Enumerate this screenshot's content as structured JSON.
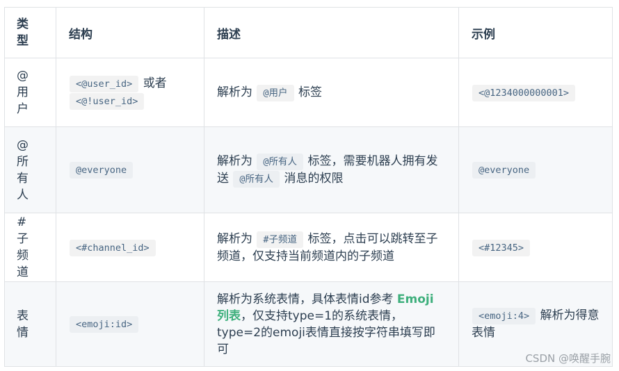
{
  "headers": {
    "type": "类型",
    "structure": "结构",
    "description": "描述",
    "example": "示例"
  },
  "rows": [
    {
      "type": "@用户",
      "structure_code1": "<@user_id>",
      "structure_sep": "或者",
      "structure_code2": "<@!user_id>",
      "desc_pre": "解析为",
      "desc_code": "@用户",
      "desc_post": "标签",
      "example_code": "<@1234000000001>"
    },
    {
      "type": "@所有人",
      "structure_code": "@everyone",
      "desc_pre": "解析为",
      "desc_code1": "@所有人",
      "desc_mid": "标签，需要机器人拥有发送",
      "desc_code2": "@所有人",
      "desc_post": "消息的权限",
      "example_code": "@everyone"
    },
    {
      "type": "#子频道",
      "structure_code": "<#channel_id>",
      "desc_pre": "解析为",
      "desc_code": "#子频道",
      "desc_post": "标签，点击可以跳转至子频道，仅支持当前频道内的子频道",
      "example_code": "<#12345>"
    },
    {
      "type": "表情",
      "structure_code": "<emoji:id>",
      "desc_pre": "解析为系统表情，具体表情id参考",
      "desc_link": "Emoji 列表",
      "desc_post": "，仅支持type=1的系统表情，type=2的emoji表情直接按字符串填写即可",
      "example_code": "<emoji:4>",
      "example_post": "解析为得意表情"
    }
  ],
  "watermark": "CSDN @唤醒手腕"
}
